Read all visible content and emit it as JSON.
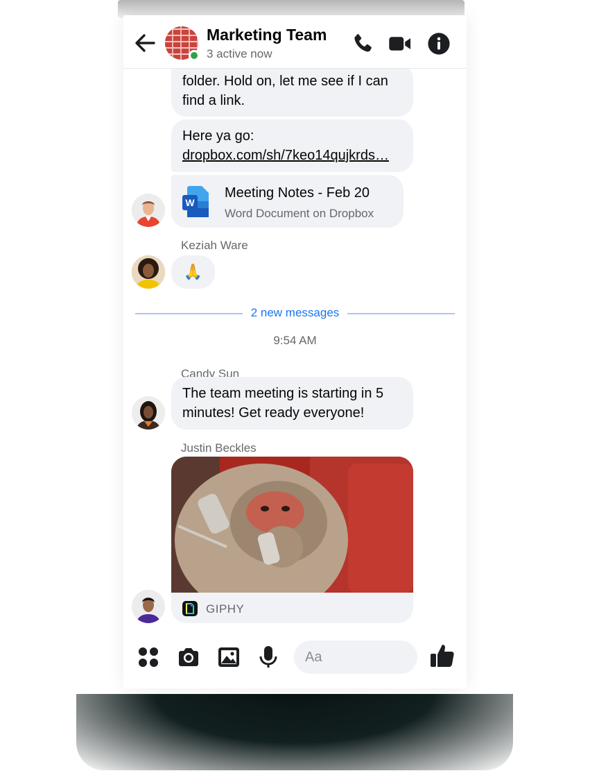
{
  "header": {
    "title": "Marketing Team",
    "status": "3 active now",
    "icons": [
      "back-arrow-icon",
      "phone-icon",
      "video-camera-icon",
      "info-icon"
    ]
  },
  "messages": {
    "m1_text": "folder. Hold on, let me see if I can find a link.",
    "m2_prefix": "Here ya go:",
    "m2_link": "dropbox.com/sh/7keo14qujkrds…",
    "attachment": {
      "title": "Meeting Notes - Feb 20",
      "subtitle": "Word Document on Dropbox",
      "icon": "word-document-icon"
    },
    "sender_keziah": "Keziah Ware",
    "keziah_reaction": "🙏",
    "new_messages_label": "2 new messages",
    "timestamp": "9:54 AM",
    "sender_candy": "Candy Sun",
    "candy_text": "The team meeting is starting in 5 minutes! Get ready everyone!",
    "sender_justin": "Justin Beckles",
    "gif_source": "GIPHY"
  },
  "composer": {
    "placeholder": "Aa",
    "icons": [
      "apps-grid-icon",
      "camera-icon",
      "gallery-icon",
      "microphone-icon",
      "thumbs-up-icon"
    ]
  },
  "colors": {
    "accent": "#1877f2",
    "bubble": "#f0f2f5",
    "online": "#31a24c",
    "icon": "#1c1e21"
  }
}
